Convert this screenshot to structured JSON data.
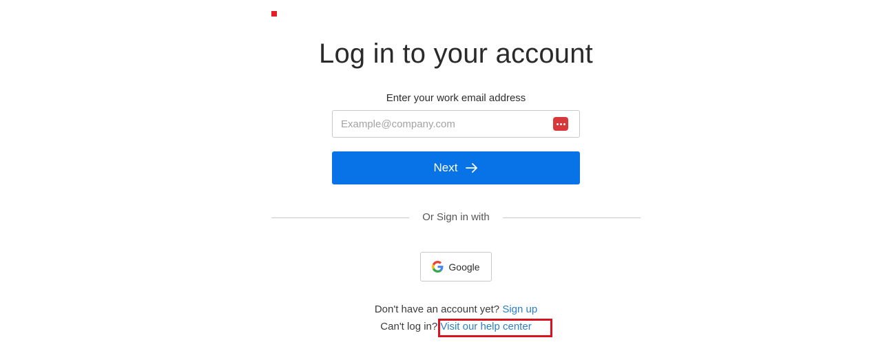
{
  "page": {
    "title": "Log in to your account"
  },
  "form": {
    "email_label": "Enter your work email address",
    "email_placeholder": "Example@company.com",
    "email_value": "",
    "next_label": "Next"
  },
  "alt_signin": {
    "divider_text": "Or Sign in with",
    "google_label": "Google"
  },
  "footer": {
    "signup_prompt": "Don't have an account yet?",
    "signup_link": "Sign up",
    "help_prompt": "Can't log in?",
    "help_link": "Visit our help center"
  },
  "icons": {
    "password_manager": "password-manager-icon",
    "next_arrow": "arrow-right-icon",
    "google": "google-logo-icon"
  },
  "colors": {
    "primary": "#0873e6",
    "link": "#2a7fc6",
    "highlight": "#d8121e",
    "brand_mark": "#e2202a"
  }
}
